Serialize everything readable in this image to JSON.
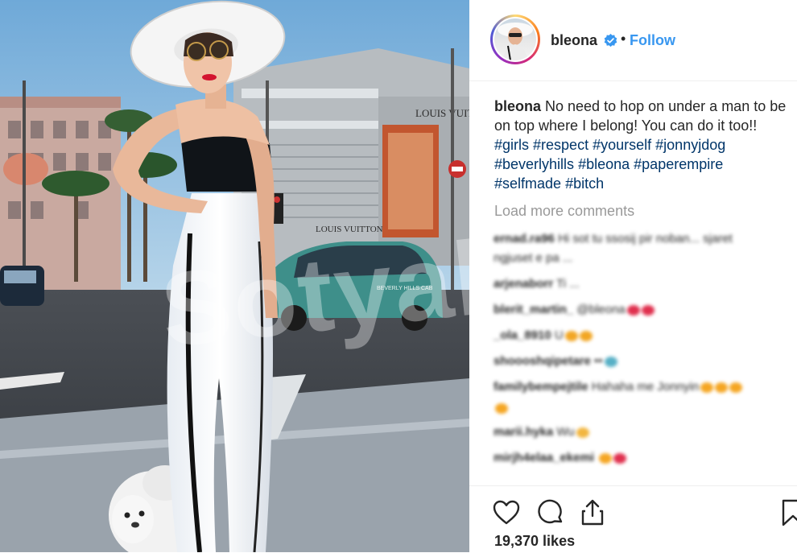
{
  "post": {
    "username": "bleona",
    "follow_label": "Follow",
    "separator": "•",
    "caption_user": "bleona",
    "caption_text": " No need to hop on under a man to be on top where I belong! You can do it too!! ",
    "hashtags": [
      "#girls",
      "#respect",
      "#yourself",
      "#jonnyjdog",
      "#beverlyhills",
      "#bleona",
      "#paperempire",
      "#selfmade",
      "#bitch"
    ],
    "load_more": "Load more comments",
    "likes": "19,370 likes"
  },
  "photo": {
    "watermark": "Sotyal",
    "store_sign_top": "LOUIS VUITT",
    "store_sign_bottom": "LOUIS VUITTON",
    "taxi_text": "BEVERLY HILLS CAB"
  },
  "comments": [
    {
      "user": "ernad.ra96",
      "text": "Hi sot tu ssosij pir noban... sjaret"
    },
    {
      "user": "",
      "text": "ngjuset e pa ..."
    },
    {
      "user": "arjenaborr",
      "text": "Ti ..."
    },
    {
      "user": "blerit_martin_",
      "text": "@bleona"
    },
    {
      "user": "_ola_8910",
      "text": "U"
    },
    {
      "user": "shoooshqipetare",
      "text": "••"
    },
    {
      "user": "familybempejtile",
      "text": "Hahaha me Jonnyin"
    },
    {
      "user": "",
      "text": ""
    },
    {
      "user": "marii.hyka",
      "text": "Wu"
    },
    {
      "user": "mirjh4elaa_ekemi",
      "text": ""
    },
    {
      "user": "",
      "text": ""
    }
  ],
  "colors": {
    "link": "#3897f0",
    "hashtag": "#003569",
    "verified": "#3897f0",
    "text": "#262626",
    "muted": "#999999"
  },
  "icons": [
    "heart-icon",
    "comment-icon",
    "share-icon",
    "bookmark-icon",
    "verified-badge-icon"
  ]
}
